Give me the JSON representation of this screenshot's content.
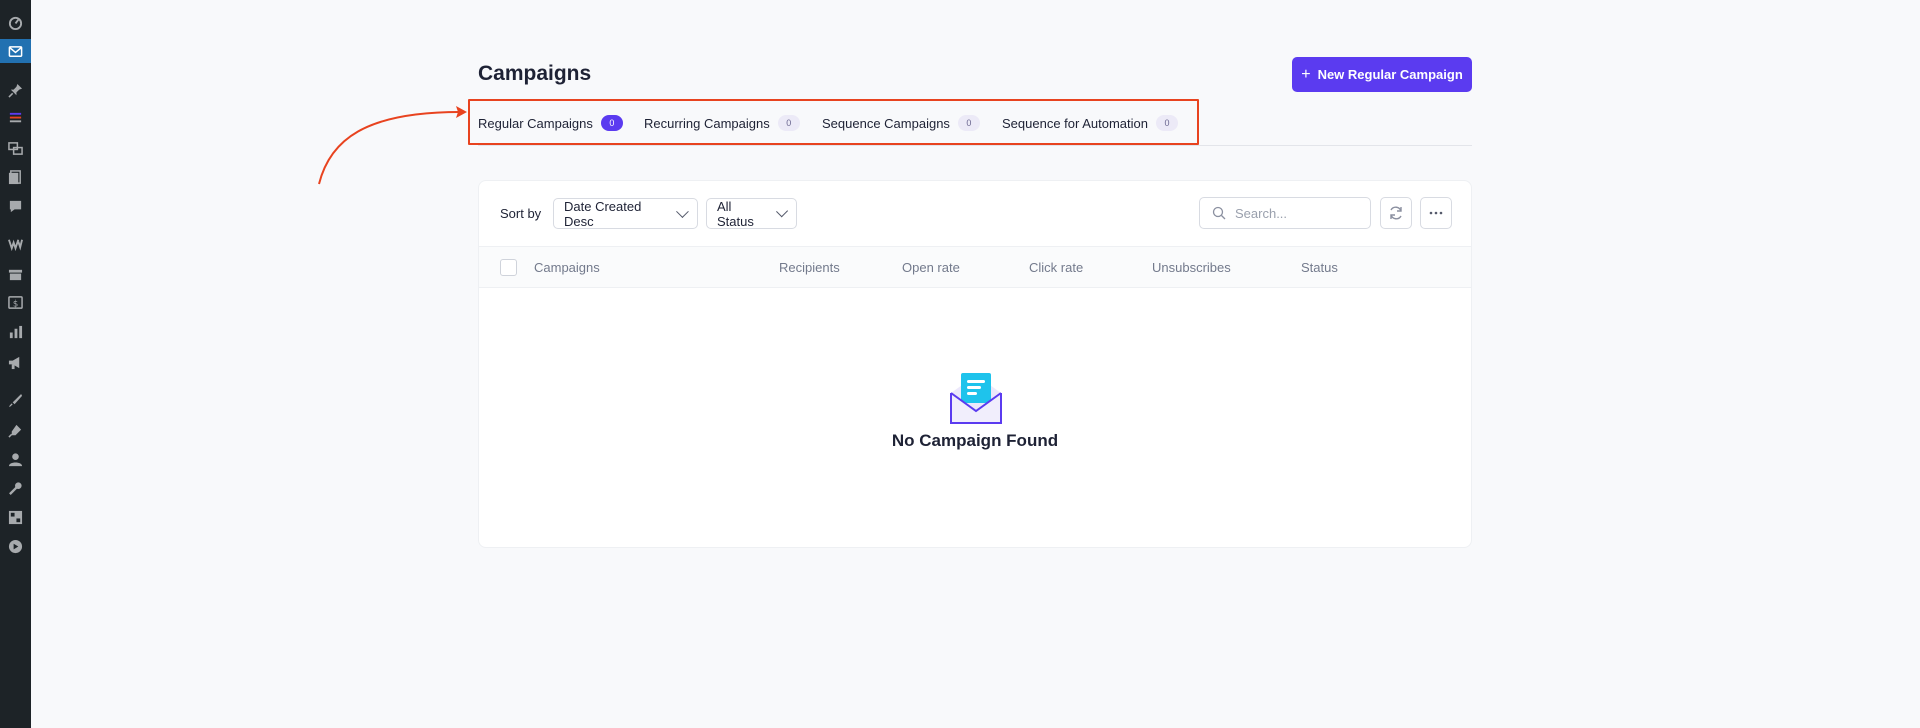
{
  "page": {
    "title": "Campaigns",
    "new_button_label": "New Regular Campaign"
  },
  "tabs": [
    {
      "label": "Regular Campaigns",
      "count": "0",
      "active": true
    },
    {
      "label": "Recurring Campaigns",
      "count": "0",
      "active": false
    },
    {
      "label": "Sequence Campaigns",
      "count": "0",
      "active": false
    },
    {
      "label": "Sequence for Automation",
      "count": "0",
      "active": false
    }
  ],
  "toolbar": {
    "sort_label": "Sort by",
    "sort_value": "Date Created Desc",
    "status_value": "All Status",
    "search_placeholder": "Search..."
  },
  "table": {
    "columns": [
      "Campaigns",
      "Recipients",
      "Open rate",
      "Click rate",
      "Unsubscribes",
      "Status"
    ]
  },
  "empty_state": {
    "message": "No Campaign Found"
  },
  "colors": {
    "primary": "#5b3bf0",
    "highlight": "#e8431f",
    "wp_sidebar": "#1d2327",
    "wp_active": "#2271b1"
  },
  "sidebar_icons": [
    "dashboard-icon",
    "mail-icon",
    "pin-icon",
    "stack-icon",
    "media-icon",
    "pages-icon",
    "comments-icon",
    "woo-icon",
    "products-icon",
    "payments-icon",
    "analytics-icon",
    "marketing-icon",
    "appearance-icon",
    "plugins-icon",
    "users-icon",
    "tools-icon",
    "settings-icon",
    "play-icon"
  ]
}
